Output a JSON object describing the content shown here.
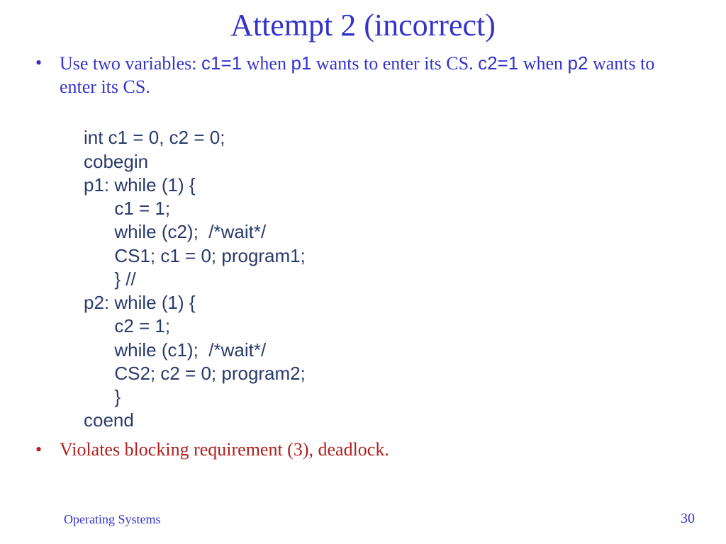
{
  "title": "Attempt 2 (incorrect)",
  "bullets": {
    "b1": {
      "t1": "Use two variables: ",
      "m1": "c1=1",
      "t2": " when ",
      "m2": "p1",
      "t3": " wants to enter its CS. ",
      "m3": "c2=1",
      "t4": " when ",
      "m4": "p2",
      "t5": " wants to enter its CS."
    },
    "b2": "Violates blocking requirement (3), deadlock."
  },
  "code": {
    "l1": "int c1 = 0, c2 = 0;",
    "l2": "cobegin",
    "l3": "p1: while (1) {",
    "l4": "      c1 = 1;",
    "l5": "      while (c2);  /*wait*/",
    "l6": "      CS1; c1 = 0; program1;",
    "l7": "      } //",
    "l8": "p2: while (1) {",
    "l9": "      c2 = 1;",
    "l10": "      while (c1);  /*wait*/",
    "l11": "      CS2; c2 = 0; program2;",
    "l12": "      }",
    "l13": "coend"
  },
  "footer": {
    "left": "Operating Systems",
    "page": "30"
  }
}
